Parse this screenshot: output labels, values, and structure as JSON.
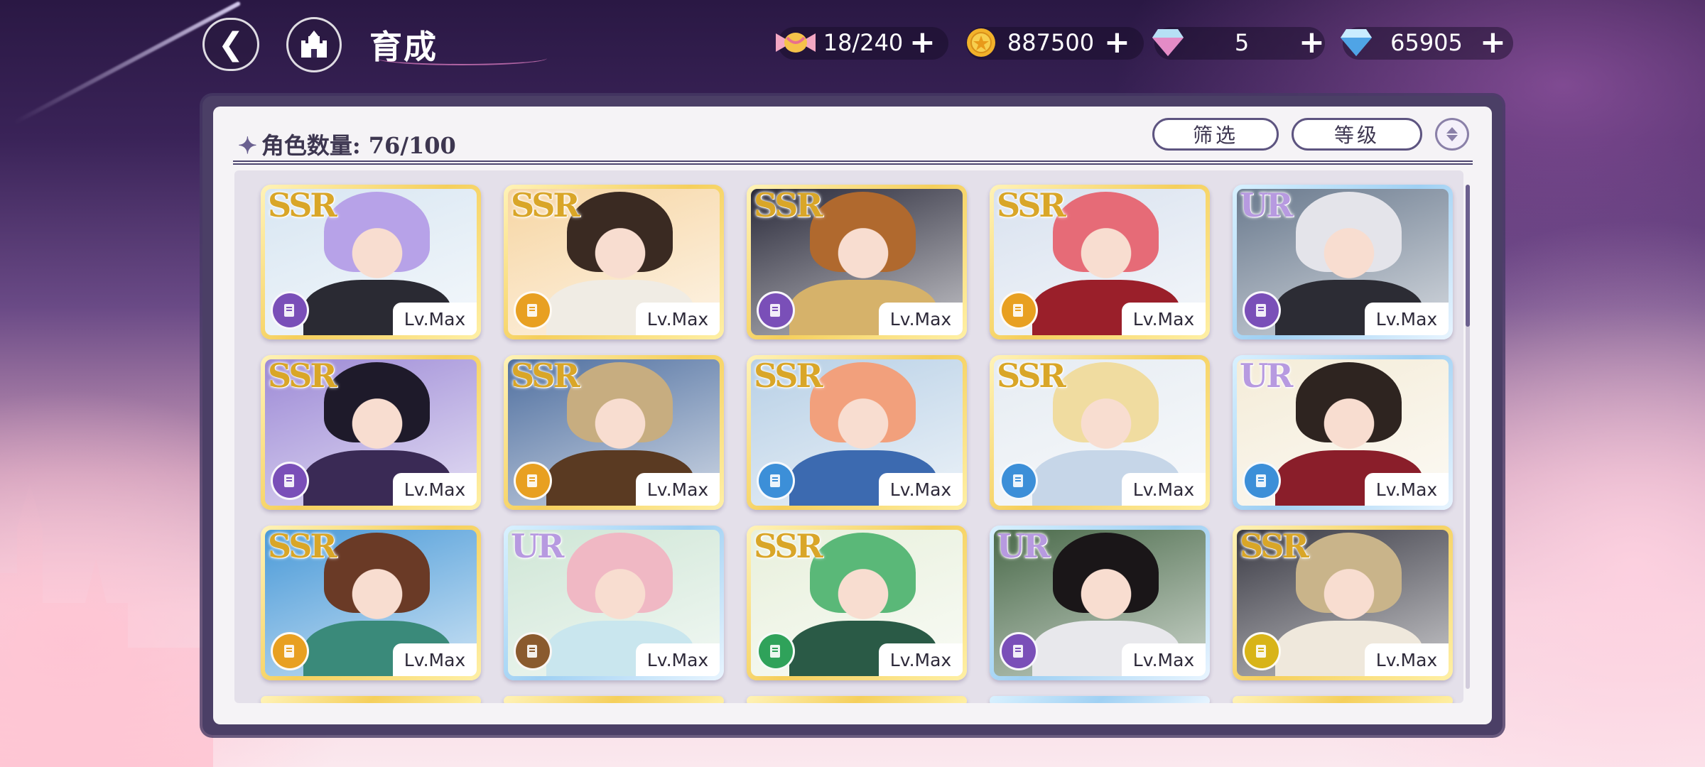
{
  "header": {
    "title": "育成",
    "resources": [
      {
        "name": "candy",
        "icon": "candy-icon",
        "value": "18/240"
      },
      {
        "name": "gold-coin",
        "icon": "coin-icon",
        "value": "887500"
      },
      {
        "name": "pink-diamond",
        "icon": "pink-diamond-icon",
        "value": "5"
      },
      {
        "name": "blue-diamond",
        "icon": "blue-diamond-icon",
        "value": "65905"
      }
    ],
    "plus_label": "+"
  },
  "panel": {
    "count_label": "角色数量:",
    "count_value": "76/100",
    "filter_label": "筛选",
    "sort_label": "等级"
  },
  "colors": {
    "ssr_frame": "#f5cf5c",
    "ur_frame": "#9fd0f3",
    "role_purple": "#7a4fb8",
    "role_orange": "#e8a021",
    "role_blue": "#3c8fd8",
    "role_brown": "#8a5a2e",
    "role_green": "#2fa25a",
    "role_yellow": "#d8b418"
  },
  "cards": [
    {
      "rarity": "SSR",
      "level": "Lv.Max",
      "role": "purple",
      "hair": "#b7a2e8",
      "bg": "#d8e6f2",
      "body": "#2a2a33"
    },
    {
      "rarity": "SSR",
      "level": "Lv.Max",
      "role": "orange",
      "hair": "#3a2a22",
      "bg": "#f7d6a4",
      "body": "#f0ece4"
    },
    {
      "rarity": "SSR",
      "level": "Lv.Max",
      "role": "purple",
      "hair": "#b0692e",
      "bg": "#2a2a3a",
      "body": "#d6b26a"
    },
    {
      "rarity": "SSR",
      "level": "Lv.Max",
      "role": "orange",
      "hair": "#e66b77",
      "bg": "#d9e2ef",
      "body": "#9a1f2a"
    },
    {
      "rarity": "UR",
      "level": "Lv.Max",
      "role": "purple",
      "hair": "#e4e4ea",
      "bg": "#6a7a8e",
      "body": "#2c2c34"
    },
    {
      "rarity": "SSR",
      "level": "Lv.Max",
      "role": "purple",
      "hair": "#1e1a2a",
      "bg": "#9d8ad6",
      "body": "#3a2a55"
    },
    {
      "rarity": "SSR",
      "level": "Lv.Max",
      "role": "orange",
      "hair": "#c7ad80",
      "bg": "#5070a0",
      "body": "#5a3a22"
    },
    {
      "rarity": "SSR",
      "level": "Lv.Max",
      "role": "blue",
      "hair": "#f2a07c",
      "bg": "#b8d0e6",
      "body": "#3c6ab0"
    },
    {
      "rarity": "SSR",
      "level": "Lv.Max",
      "role": "blue",
      "hair": "#f0dca0",
      "bg": "#e6ecf2",
      "body": "#c6d6e8"
    },
    {
      "rarity": "UR",
      "level": "Lv.Max",
      "role": "blue",
      "hair": "#2e2420",
      "bg": "#f4ecd8",
      "body": "#8a1e2a"
    },
    {
      "rarity": "SSR",
      "level": "Lv.Max",
      "role": "orange",
      "hair": "#6a3a26",
      "bg": "#4a9ad8",
      "body": "#3a8a7a"
    },
    {
      "rarity": "UR",
      "level": "Lv.Max",
      "role": "brown",
      "hair": "#f0b8c4",
      "bg": "#cfe6d6",
      "body": "#c9e6ee"
    },
    {
      "rarity": "SSR",
      "level": "Lv.Max",
      "role": "green",
      "hair": "#5ab878",
      "bg": "#e8f0dc",
      "body": "#2a5a46"
    },
    {
      "rarity": "UR",
      "level": "Lv.Max",
      "role": "purple",
      "hair": "#1a1618",
      "bg": "#4a6a4a",
      "body": "#e8e8ec"
    },
    {
      "rarity": "SSR",
      "level": "Lv.Max",
      "role": "yellow",
      "hair": "#c9b48a",
      "bg": "#3a3a44",
      "body": "#efe8dc"
    }
  ]
}
